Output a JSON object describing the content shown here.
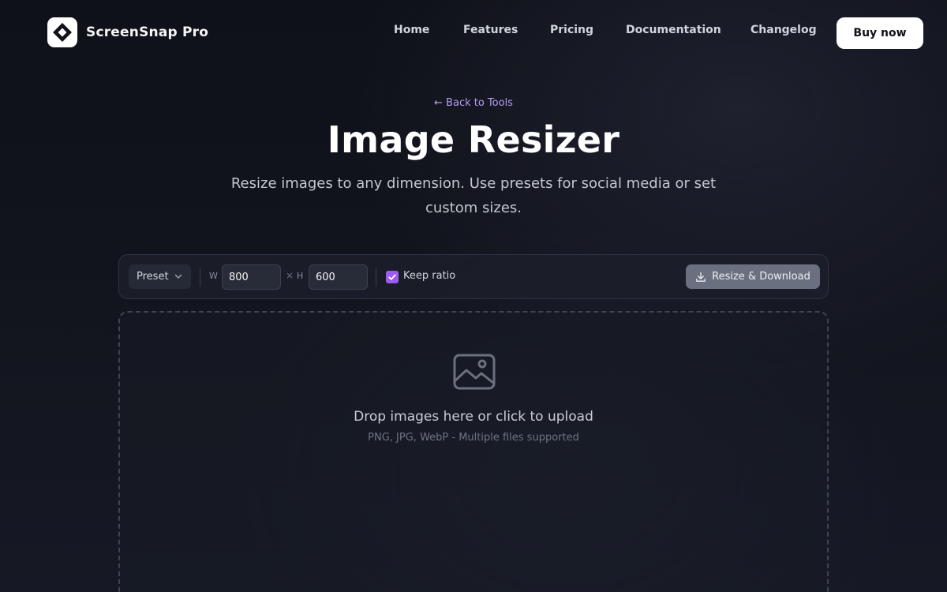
{
  "app": {
    "name": "ScreenSnap Pro",
    "logo_icon": "diamond-logo-icon"
  },
  "nav": {
    "links": [
      "Home",
      "Features",
      "Pricing",
      "Documentation",
      "Changelog"
    ],
    "buy_label": "Buy now"
  },
  "hero": {
    "back_link": "← Back to Tools",
    "title": "Image Resizer",
    "subtitle": "Resize images to any dimension. Use presets for social media or set custom sizes."
  },
  "toolbar": {
    "preset_label": "Preset",
    "width_label": "W",
    "width_value": "800",
    "times": "×",
    "height_label": "H",
    "height_value": "600",
    "keep_ratio_label": "Keep ratio",
    "keep_ratio_checked": true,
    "resize_button_label": "Resize & Download",
    "resize_button_icon": "download-icon"
  },
  "dropzone": {
    "icon": "image-icon",
    "title": "Drop images here or click to upload",
    "hint": "PNG, JPG, WebP - Multiple files supported"
  },
  "colors": {
    "accent": "#9b5cf6",
    "back_link": "#b79cf2",
    "background": "#12141d"
  }
}
